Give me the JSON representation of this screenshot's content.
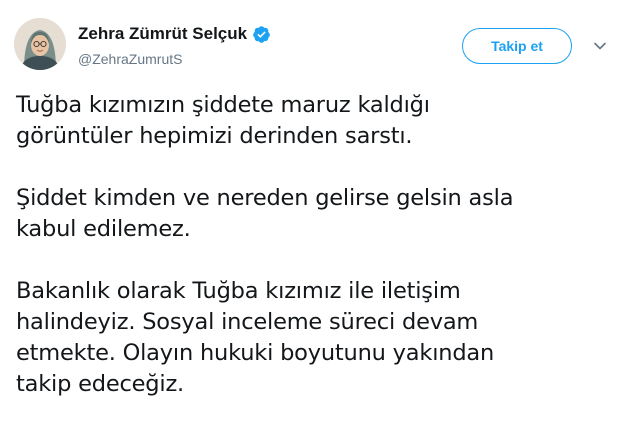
{
  "author": {
    "display_name": "Zehra Zümrüt Selçuk",
    "handle": "@ZehraZumrutS",
    "verified": true,
    "avatar_icon": "profile-photo"
  },
  "actions": {
    "follow_label": "Takip et",
    "menu_icon": "chevron-down-icon"
  },
  "tweet": {
    "paragraphs": [
      {
        "lines": [
          "Tuğba kızımızın şiddete maruz kaldığı",
          "görüntüler hepimizi derinden sarstı."
        ]
      },
      {
        "lines": [
          "Şiddet kimden ve nereden gelirse gelsin asla",
          "kabul edilemez."
        ]
      },
      {
        "lines": [
          "Bakanlık olarak Tuğba kızımız ile iletişim",
          "halindeyiz. Sosyal inceleme süreci devam",
          "etmekte. Olayın hukuki boyutunu yakından",
          "takip edeceğiz."
        ]
      }
    ]
  },
  "colors": {
    "accent": "#1da1f2",
    "text": "#14171a",
    "secondary_text": "#657786"
  }
}
